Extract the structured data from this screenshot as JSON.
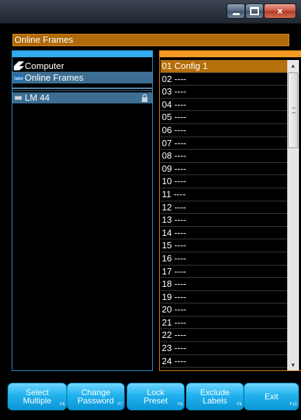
{
  "window": {
    "min_icon": "minimize-icon",
    "max_icon": "maximize-icon",
    "close_glyph": "×"
  },
  "header": {
    "title": "Online Frames"
  },
  "tree": {
    "items": [
      {
        "label": "Computer",
        "icon": "computer-icon"
      },
      {
        "label": "Online Frames",
        "icon": "lake-icon"
      }
    ],
    "device": {
      "label": "LM 44",
      "icon": "device-icon",
      "lock_icon": "lock-icon"
    }
  },
  "presets": [
    "01  Config 1",
    "02  ----",
    "03  ----",
    "04  ----",
    "05  ----",
    "06  ----",
    "07  ----",
    "08  ----",
    "09  ----",
    "10  ----",
    "11  ----",
    "12  ----",
    "13  ----",
    "14  ----",
    "15  ----",
    "16  ----",
    "17  ----",
    "18  ----",
    "19  ----",
    "20  ----",
    "21  ----",
    "22  ----",
    "23  ----",
    "24  ----"
  ],
  "buttons": {
    "select_multiple": {
      "label": "Select\nMultiple",
      "fkey": "F6"
    },
    "change_password": {
      "label": "Change\nPassword",
      "fkey": "F7"
    },
    "lock_preset": {
      "label": "Lock\nPreset",
      "fkey": "F8"
    },
    "exclude_labels": {
      "label": "Exclude\nLabels",
      "fkey": "F9"
    },
    "exit": {
      "label": "Exit",
      "fkey": "F10"
    }
  },
  "colors": {
    "accent_orange": "#b06a0a",
    "accent_blue": "#33a9f0",
    "selection_blue": "#3d6e92",
    "button_blue": "#22b2ee"
  }
}
